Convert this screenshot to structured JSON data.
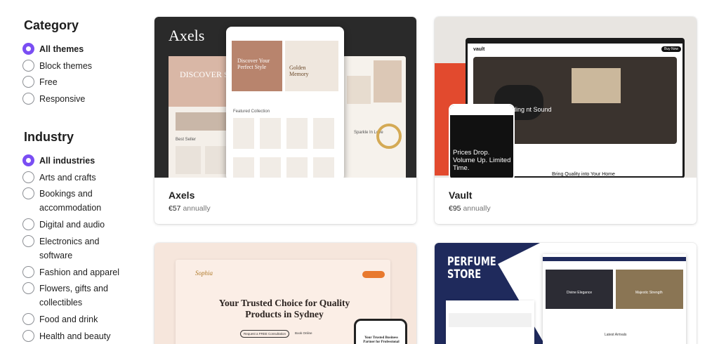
{
  "sidebar": {
    "category": {
      "title": "Category",
      "options": [
        {
          "label": "All themes",
          "selected": true
        },
        {
          "label": "Block themes",
          "selected": false
        },
        {
          "label": "Free",
          "selected": false
        },
        {
          "label": "Responsive",
          "selected": false
        }
      ]
    },
    "industry": {
      "title": "Industry",
      "options": [
        {
          "label": "All industries",
          "selected": true
        },
        {
          "label": "Arts and crafts",
          "selected": false
        },
        {
          "label": "Bookings and accommodation",
          "selected": false
        },
        {
          "label": "Digital and audio",
          "selected": false
        },
        {
          "label": "Electronics and software",
          "selected": false
        },
        {
          "label": "Fashion and apparel",
          "selected": false
        },
        {
          "label": "Flowers, gifts and collectibles",
          "selected": false
        },
        {
          "label": "Food and drink",
          "selected": false
        },
        {
          "label": "Health and beauty",
          "selected": false
        }
      ]
    }
  },
  "themes": [
    {
      "name": "Axels",
      "price": "€57",
      "period": "annually",
      "preview": {
        "brand": "Axels",
        "headline1": "Discover Your Perfect Style",
        "headline2": "Golden Memory",
        "section": "Featured Collection",
        "side_text": "DISCOVER S WITH ST",
        "best_seller": "Best Seller",
        "sparkle": "Sparkle In Love"
      }
    },
    {
      "name": "Vault",
      "price": "€95",
      "period": "annually",
      "preview": {
        "logo": "vault",
        "hero_text": "ding nt Sound",
        "phone_text": "Prices Drop. Volume Up. Limited Time.",
        "tagline": "Bring Quality into Your Home",
        "button": "Buy Now"
      }
    },
    {
      "name": "Sophia",
      "price": "",
      "period": "",
      "preview": {
        "brand": "Sophia",
        "headline": "Your Trusted Choice for Quality Products in Sydney",
        "cta": "Request a FREE Consultation",
        "link": "Book Online",
        "phone_text": "Your Trusted Business Partner for Professional Services"
      }
    },
    {
      "name": "Perfume Store",
      "price": "",
      "period": "",
      "preview": {
        "brand": "PERFUME STORE",
        "banner1": "Divine Elegance",
        "banner2": "Majestic Strength",
        "section": "Latest Arrivals"
      }
    }
  ],
  "colors": {
    "accent": "#7a4ef3",
    "text": "#1e1e1e",
    "muted": "#757575"
  }
}
